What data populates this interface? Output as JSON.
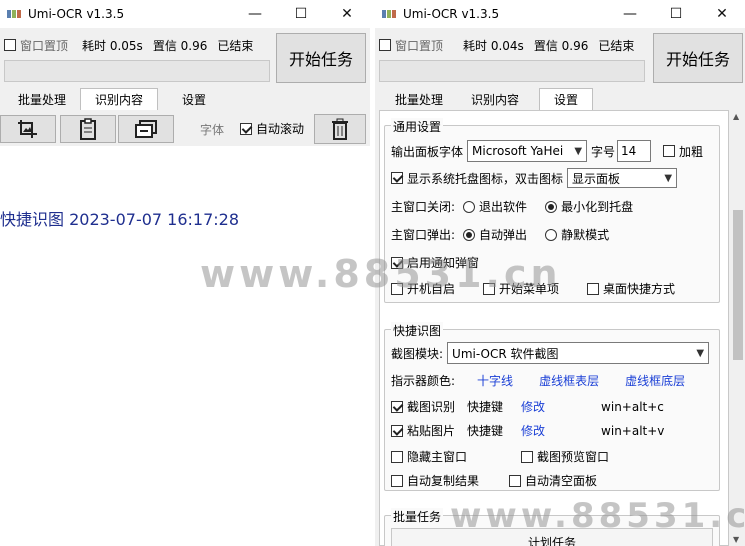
{
  "left_window": {
    "title": "Umi-OCR v1.3.5",
    "pin_label": "窗口置顶",
    "time": "耗时 0.05s",
    "confidence": "置信 0.96",
    "status": "已结束",
    "start_label": "开始任务",
    "tabs": [
      "批量处理",
      "识别内容",
      "设置"
    ],
    "font_label": "字体",
    "autoscroll_label": "自动滚动",
    "ocr_text": "快捷识图 2023-07-07 16:17:28"
  },
  "right_window": {
    "title": "Umi-OCR v1.3.5",
    "pin_label": "窗口置顶",
    "time": "耗时 0.04s",
    "confidence": "置信 0.96",
    "status": "已结束",
    "start_label": "开始任务",
    "tabs": [
      "批量处理",
      "识别内容",
      "设置"
    ],
    "general": {
      "title": "通用设置",
      "font_label": "输出面板字体",
      "font_value": "Microsoft YaHei",
      "size_label": "字号",
      "size_value": "14",
      "bold_label": "加粗",
      "tray_label": "显示系统托盘图标，双击图标",
      "tray_value": "显示面板",
      "close_label": "主窗口关闭:",
      "close_opt1": "退出软件",
      "close_opt2": "最小化到托盘",
      "popup_label": "主窗口弹出:",
      "popup_opt1": "自动弹出",
      "popup_opt2": "静默模式",
      "notify_label": "启用通知弹窗",
      "autostart_label": "开机自启",
      "startmenu_label": "开始菜单项",
      "desktop_label": "桌面快捷方式"
    },
    "quick": {
      "title": "快捷识图",
      "module_label": "截图模块:",
      "module_value": "Umi-OCR 软件截图",
      "indicator_label": "指示器颜色:",
      "color1": "十字线",
      "color2": "虚线框表层",
      "color3": "虚线框底层",
      "shot_label": "截图识别",
      "hotkey_label": "快捷键",
      "modify_label": "修改",
      "shot_keys": "win+alt+c",
      "paste_label": "粘贴图片",
      "paste_keys": "win+alt+v",
      "hide_label": "隐藏主窗口",
      "preview_label": "截图预览窗口",
      "copy_label": "自动复制结果",
      "clear_label": "自动清空面板"
    },
    "batch": {
      "title": "批量任务",
      "plan_label": "计划任务"
    }
  },
  "watermark": "www.88531.cn",
  "colors": {
    "link": "#1a3fd6",
    "ocr_text": "#1f2f8f"
  }
}
